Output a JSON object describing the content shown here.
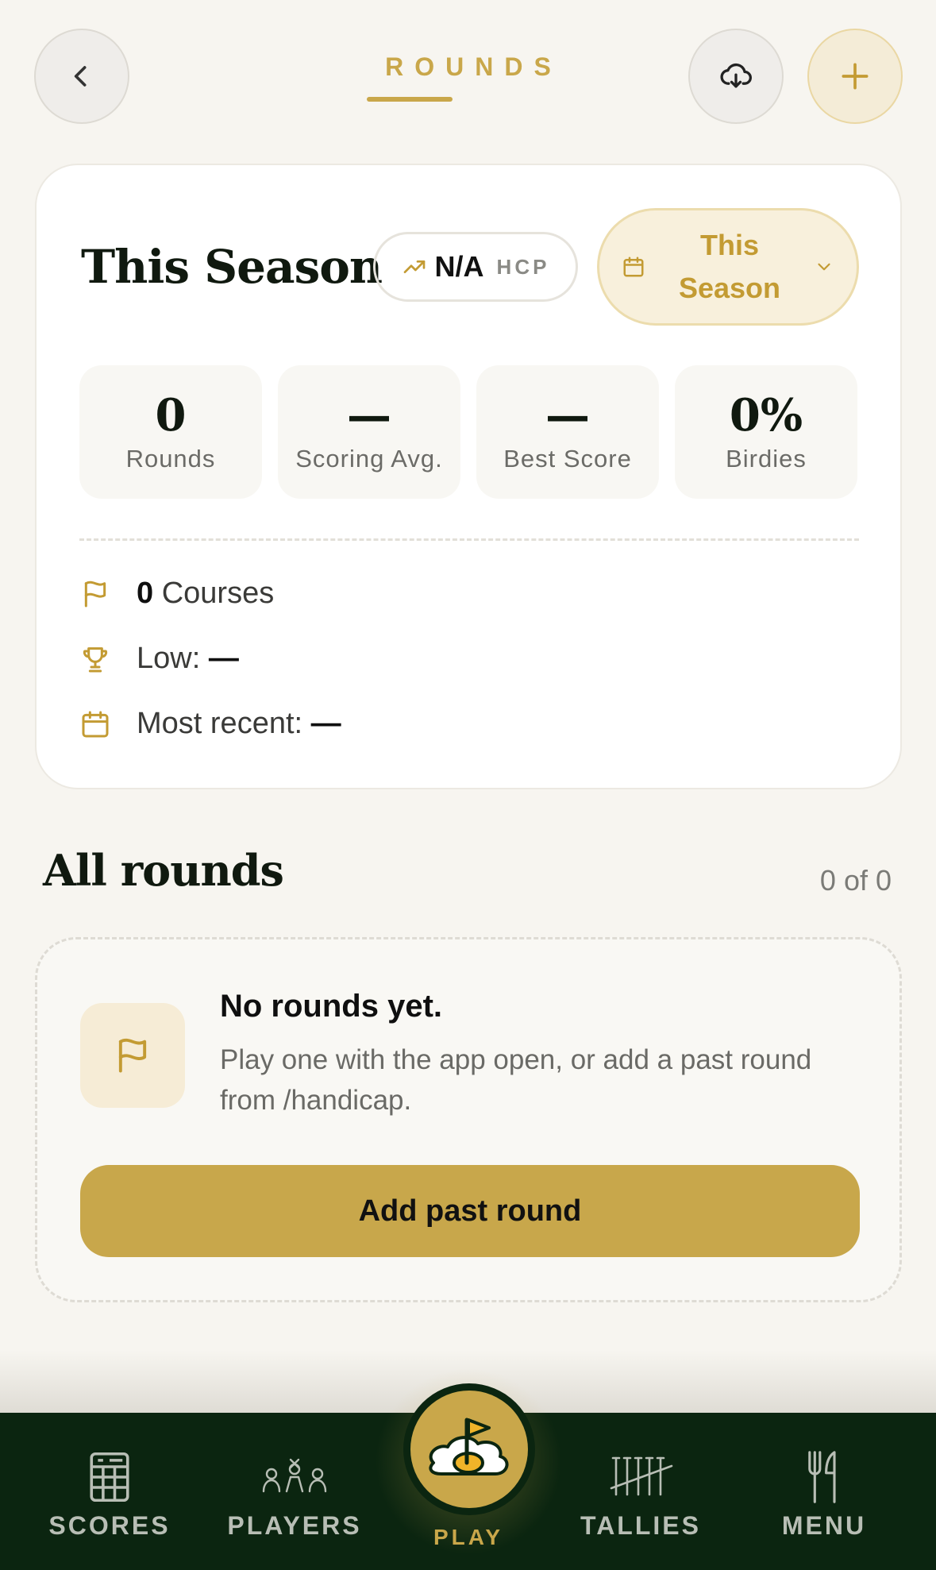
{
  "header": {
    "title": "ROUNDS",
    "back_icon": "chevron-left-icon",
    "download_icon": "cloud-download-icon",
    "add_icon": "plus-icon"
  },
  "summary": {
    "title": "This Season",
    "handicap": {
      "value": "N/A",
      "label": "HCP",
      "icon": "trending-up-icon"
    },
    "period_select": {
      "value": "This Season",
      "icon": "calendar-icon",
      "chevron": "chevron-down-icon"
    },
    "stats": [
      {
        "value": "0",
        "label": "Rounds"
      },
      {
        "value": "—",
        "label": "Scoring Avg."
      },
      {
        "value": "—",
        "label": "Best Score"
      },
      {
        "value": "0%",
        "label": "Birdies"
      }
    ],
    "meta": {
      "courses_count": "0",
      "courses_label": "Courses",
      "low_label": "Low:",
      "low_value": "—",
      "recent_label": "Most recent:",
      "recent_value": "—"
    }
  },
  "all_rounds": {
    "title": "All rounds",
    "count": "0 of 0",
    "empty": {
      "title": "No rounds yet.",
      "description": "Play one with the app open, or add a past round from /handicap.",
      "button": "Add past round"
    }
  },
  "nav": {
    "items": [
      {
        "label": "SCORES",
        "icon": "scorecard-icon"
      },
      {
        "label": "PLAYERS",
        "icon": "players-icon"
      },
      {
        "label": "PLAY",
        "icon": "golf-flag-egg-icon"
      },
      {
        "label": "TALLIES",
        "icon": "tallies-icon"
      },
      {
        "label": "MENU",
        "icon": "utensils-icon"
      }
    ]
  },
  "colors": {
    "accent": "#c9a74a",
    "nav_background": "#0b2510",
    "page_background": "#f7f5f0"
  }
}
